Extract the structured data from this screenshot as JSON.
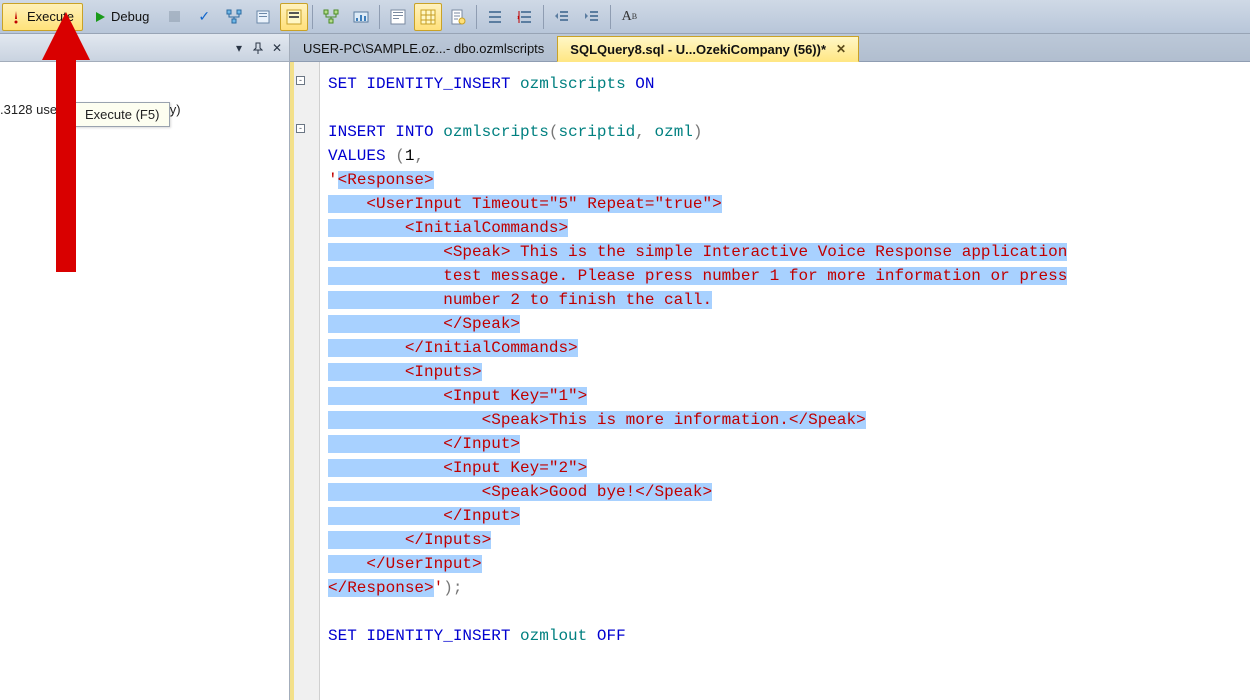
{
  "toolbar": {
    "execute_label": "Execute",
    "debug_label": "Debug"
  },
  "tooltip": {
    "text": "Execute (F5)"
  },
  "sidebar": {
    "entry": ".3128  user-PC\\OzekiCompany)"
  },
  "tabs": {
    "inactive": "USER-PC\\SAMPLE.oz...- dbo.ozmlscripts",
    "active": "SQLQuery8.sql - U...OzekiCompany (56))*"
  },
  "code": {
    "l1a": "SET IDENTITY_INSERT",
    "l1b": "ozmlscripts",
    "l1c": "ON",
    "l3a": "INSERT INTO",
    "l3b": "ozmlscripts",
    "l3c": "scriptid",
    "l3d": "ozml",
    "l4a": "VALUES ",
    "l4n": "1",
    "l5": "<Response>",
    "l6": "    <UserInput Timeout=\"5\" Repeat=\"true\">",
    "l7": "        <InitialCommands>",
    "l8a": "            <Speak>",
    "l8b": " This is the simple Interactive Voice Response application",
    "l9": "            test message. Please press number 1 for more information or press",
    "l10": "            number 2 to finish the call.",
    "l11": "            </Speak>",
    "l12": "        </InitialCommands>",
    "l13": "        <Inputs>",
    "l14": "            <Input Key=\"1\">",
    "l15a": "                <Speak>",
    "l15b": "This is more information.",
    "l15c": "</Speak>",
    "l16": "            </Input>",
    "l17": "            <Input Key=\"2\">",
    "l18a": "                <Speak>",
    "l18b": "Good bye!",
    "l18c": "</Speak>",
    "l19": "            </Input>",
    "l20": "        </Inputs>",
    "l21": "    </UserInput>",
    "l22a": "</Response>",
    "l22b": ");",
    "l24a": "SET IDENTITY_INSERT",
    "l24b": "ozmlout",
    "l24c": "OFF"
  }
}
